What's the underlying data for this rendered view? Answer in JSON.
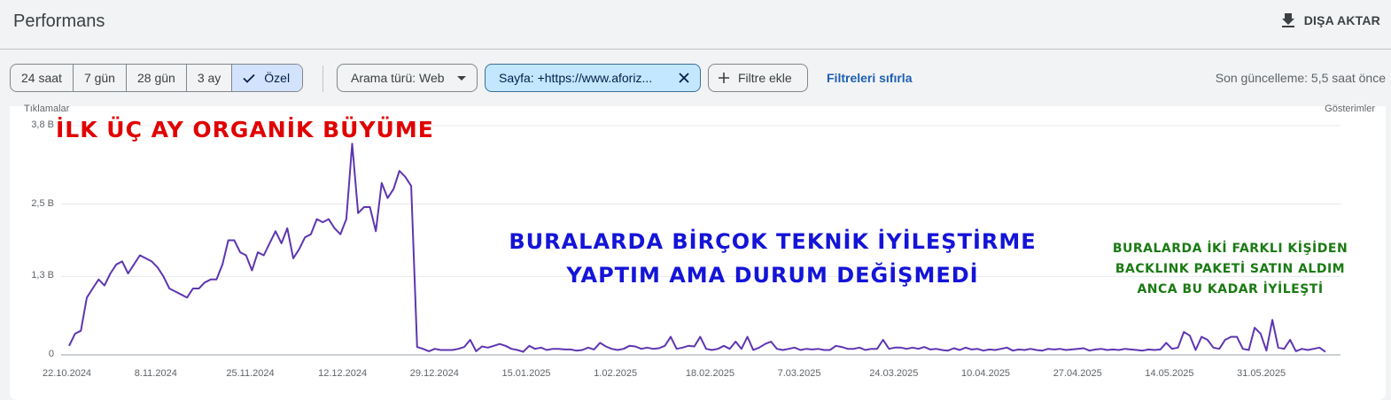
{
  "header": {
    "title": "Performans",
    "export_label": "DIŞA AKTAR"
  },
  "filters": {
    "date_ranges": [
      "24 saat",
      "7 gün",
      "28 gün",
      "3 ay"
    ],
    "date_active": "Özel",
    "search_type": "Arama türü: Web",
    "page_filter": "Sayfa: +https://www.aforiz...",
    "add_filter": "Filtre ekle",
    "reset": "Filtreleri sıfırla",
    "last_update": "Son güncelleme: 5,5 saat önce"
  },
  "annotations": {
    "red": "İLK ÜÇ AY ORGANİK BÜYÜME",
    "blue_1": "BURALARDA BİRÇOK TEKNİK İYİLEŞTİRME",
    "blue_2": "YAPTIM AMA DURUM DEĞİŞMEDİ",
    "green_1": "BURALARDA İKİ FARKLI KİŞİDEN",
    "green_2": "BACKLINK PAKETİ SATIN ALDIM",
    "green_3": "ANCA BU KADAR İYİLEŞTİ"
  },
  "colors": {
    "line": "#5e35b1",
    "accent": "#1a73e8",
    "active_chip": "#c2e7ff"
  },
  "chart_data": {
    "type": "line",
    "left_axis_label": "Tıklamalar",
    "right_axis_label": "Gösterimler",
    "yticks": [
      "0",
      "1,3 B",
      "2,5 B",
      "3,8 B"
    ],
    "ytick_values": [
      0,
      1.3,
      2.5,
      3.8
    ],
    "ylim": [
      0,
      3.8
    ],
    "xticks": [
      "22.10.2024",
      "8.11.2024",
      "25.11.2024",
      "12.12.2024",
      "29.12.2024",
      "15.01.2025",
      "1.02.2025",
      "18.02.2025",
      "7.03.2025",
      "24.03.2025",
      "10.04.2025",
      "27.04.2025",
      "14.05.2025",
      "31.05.2025"
    ],
    "grid": true,
    "series": [
      {
        "color": "#5e35b1",
        "values": [
          0.15,
          0.35,
          0.4,
          0.95,
          1.1,
          1.25,
          1.15,
          1.35,
          1.5,
          1.55,
          1.35,
          1.5,
          1.65,
          1.6,
          1.55,
          1.45,
          1.3,
          1.1,
          1.05,
          1.0,
          0.95,
          1.1,
          1.1,
          1.2,
          1.25,
          1.25,
          1.5,
          1.9,
          1.9,
          1.7,
          1.65,
          1.4,
          1.7,
          1.65,
          1.85,
          2.05,
          1.85,
          2.1,
          1.6,
          1.75,
          1.95,
          2.0,
          2.25,
          2.2,
          2.25,
          2.1,
          2.0,
          2.25,
          3.5,
          2.35,
          2.45,
          2.45,
          2.05,
          2.85,
          2.6,
          2.75,
          3.05,
          2.95,
          2.8,
          0.13,
          0.1,
          0.06,
          0.1,
          0.08,
          0.08,
          0.08,
          0.1,
          0.13,
          0.25,
          0.06,
          0.14,
          0.12,
          0.15,
          0.18,
          0.15,
          0.1,
          0.08,
          0.05,
          0.15,
          0.1,
          0.12,
          0.08,
          0.1,
          0.1,
          0.09,
          0.09,
          0.07,
          0.08,
          0.12,
          0.09,
          0.2,
          0.14,
          0.1,
          0.08,
          0.1,
          0.15,
          0.14,
          0.1,
          0.12,
          0.1,
          0.11,
          0.15,
          0.3,
          0.1,
          0.12,
          0.15,
          0.14,
          0.3,
          0.1,
          0.08,
          0.1,
          0.15,
          0.1,
          0.22,
          0.1,
          0.3,
          0.08,
          0.12,
          0.18,
          0.22,
          0.1,
          0.08,
          0.1,
          0.12,
          0.08,
          0.1,
          0.09,
          0.1,
          0.08,
          0.08,
          0.15,
          0.13,
          0.1,
          0.1,
          0.12,
          0.08,
          0.1,
          0.1,
          0.25,
          0.1,
          0.12,
          0.12,
          0.1,
          0.12,
          0.1,
          0.13,
          0.09,
          0.1,
          0.08,
          0.07,
          0.11,
          0.08,
          0.12,
          0.09,
          0.1,
          0.07,
          0.09,
          0.08,
          0.1,
          0.12,
          0.07,
          0.09,
          0.08,
          0.1,
          0.08,
          0.07,
          0.1,
          0.09,
          0.1,
          0.08,
          0.09,
          0.1,
          0.11,
          0.07,
          0.09,
          0.1,
          0.08,
          0.09,
          0.08,
          0.1,
          0.09,
          0.08,
          0.07,
          0.09,
          0.08,
          0.09,
          0.2,
          0.1,
          0.12,
          0.38,
          0.32,
          0.08,
          0.3,
          0.25,
          0.12,
          0.1,
          0.25,
          0.3,
          0.3,
          0.1,
          0.08,
          0.45,
          0.35,
          0.07,
          0.58,
          0.12,
          0.1,
          0.25,
          0.06,
          0.1,
          0.08,
          0.1,
          0.12,
          0.05
        ]
      }
    ]
  }
}
